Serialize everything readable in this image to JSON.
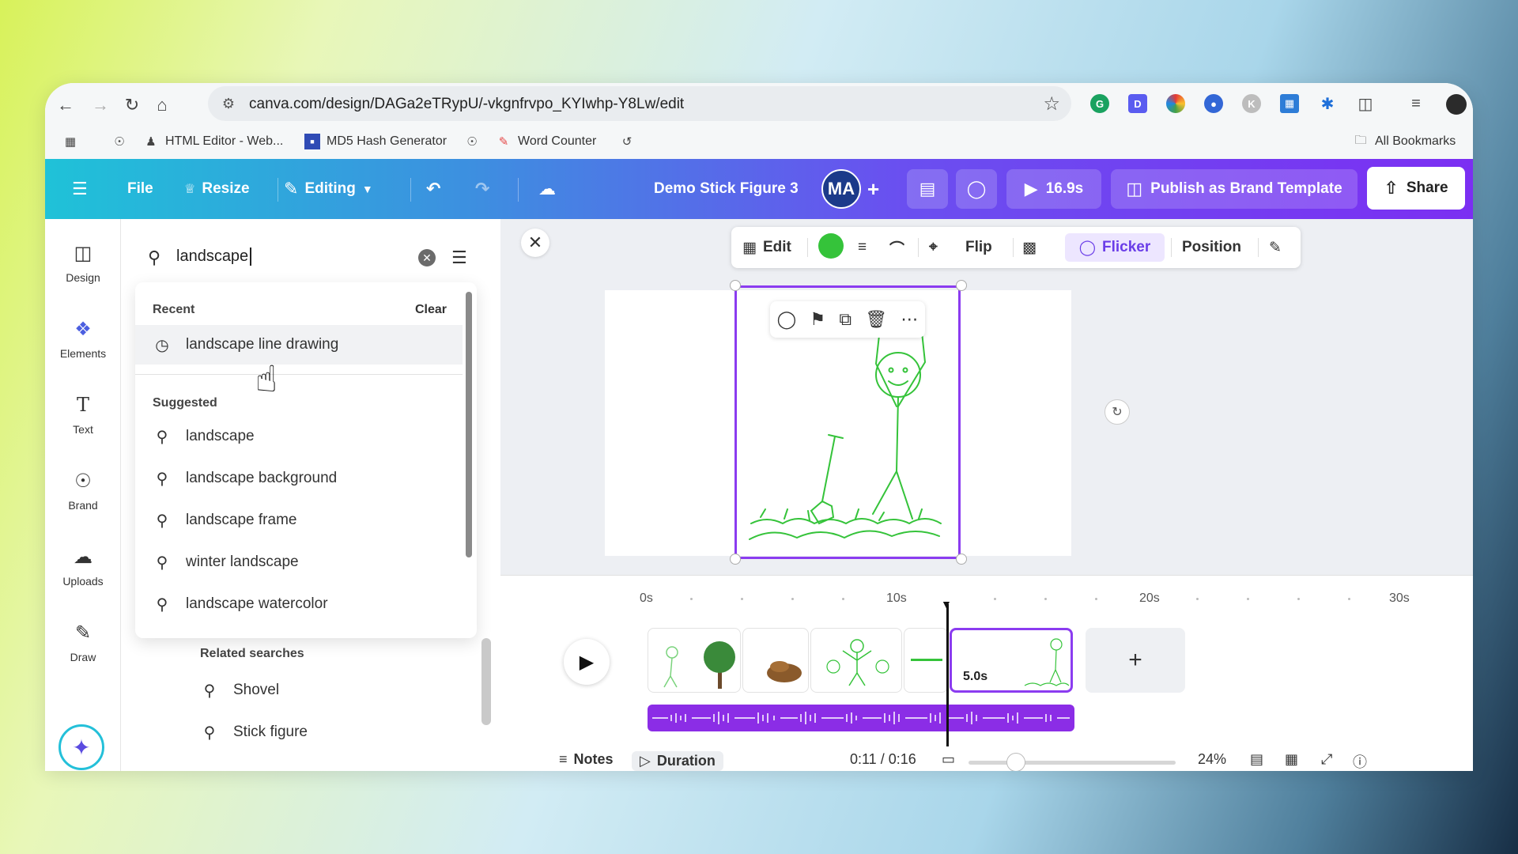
{
  "browser": {
    "url": "canva.com/design/DAGa2eTRypU/-vkgnfrvpo_KYIwhp-Y8Lw/edit",
    "bookmarks": [
      {
        "label": "HTML Editor - Web...",
        "icon": "spy-icon"
      },
      {
        "label": "MD5 Hash Generator",
        "icon": "md5-icon"
      },
      {
        "label": "Word Counter",
        "icon": "word-counter-icon"
      }
    ],
    "all_bookmarks_label": "All Bookmarks"
  },
  "toolbar": {
    "file_label": "File",
    "resize_label": "Resize",
    "editing_label": "Editing",
    "design_title": "Demo Stick Figure 3",
    "avatar_initials": "MA",
    "play_duration": "16.9s",
    "publish_label": "Publish as Brand Template",
    "share_label": "Share"
  },
  "rail": {
    "items": [
      {
        "label": "Design",
        "icon": "design-icon"
      },
      {
        "label": "Elements",
        "icon": "elements-icon"
      },
      {
        "label": "Text",
        "icon": "text-icon"
      },
      {
        "label": "Brand",
        "icon": "brand-icon"
      },
      {
        "label": "Uploads",
        "icon": "uploads-icon"
      },
      {
        "label": "Draw",
        "icon": "draw-icon"
      }
    ]
  },
  "search": {
    "query": "landscape",
    "recent_heading": "Recent",
    "clear_label": "Clear",
    "recent": [
      "landscape line drawing"
    ],
    "suggested_heading": "Suggested",
    "suggested": [
      "landscape",
      "landscape background",
      "landscape frame",
      "winter landscape",
      "landscape watercolor"
    ],
    "related_heading": "Related searches",
    "related": [
      "Shovel",
      "Stick figure"
    ]
  },
  "context_bar": {
    "edit_label": "Edit",
    "color": "#35c33a",
    "flip_label": "Flip",
    "flicker_label": "Flicker",
    "position_label": "Position"
  },
  "timeline": {
    "ticks": [
      "0s",
      "10s",
      "20s",
      "30s"
    ],
    "selected_clip_duration": "5.0s",
    "notes_label": "Notes",
    "duration_label": "Duration",
    "time": "0:11 / 0:16",
    "zoom": "24%"
  },
  "colors": {
    "accent": "#8b3cf0",
    "drawing_green": "#35c33a"
  }
}
